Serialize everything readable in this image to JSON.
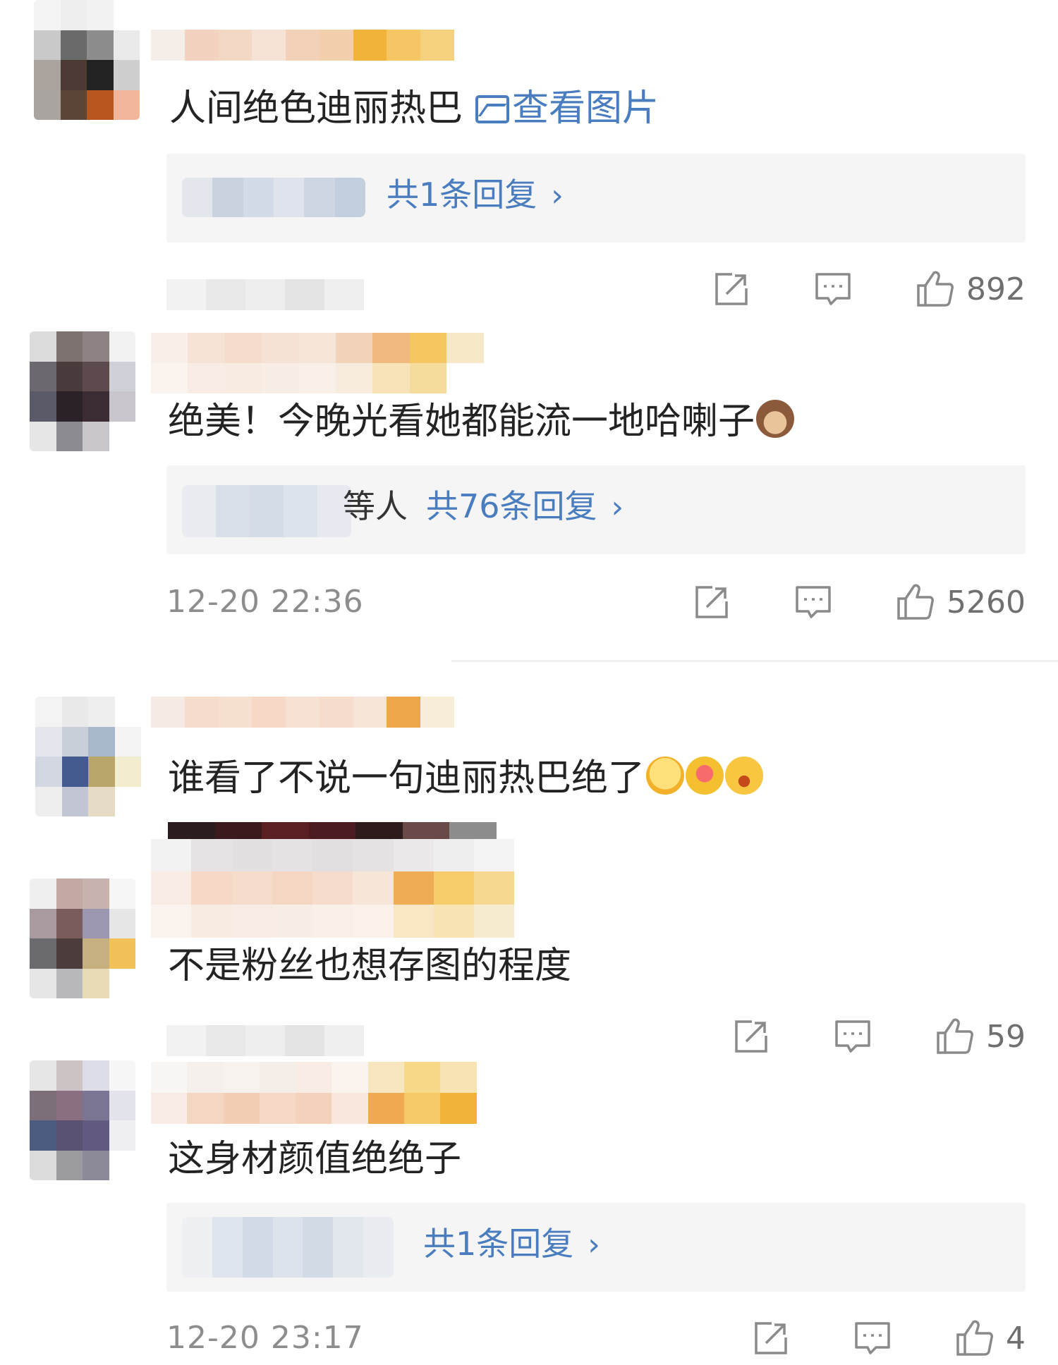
{
  "comments": [
    {
      "text": "人间绝色迪丽热巴",
      "view_image": "查看图片",
      "reply": {
        "extra": "",
        "count_label": "共1条回复"
      },
      "timestamp": "",
      "likes": "892",
      "avatar_colors": [
        "#c9c9c9",
        "#6a6a6a",
        "#8d8d8d",
        "#eaeaea",
        "#aaa39e",
        "#4b3b34",
        "#222222",
        "#d0cfcf",
        "#a9a49f",
        "#5b4638",
        "#b8561f",
        "#f2b69b",
        "#e5e5e5",
        "#dcd7d3",
        "#efe2d8",
        "#ffffff"
      ]
    },
    {
      "text": "绝美！今晚光看她都能流一地哈喇子",
      "emojis": [
        "monkey"
      ],
      "reply": {
        "extra": "等人",
        "count_label": "共76条回复"
      },
      "timestamp": "12-20 22:36",
      "likes": "5260",
      "avatar_colors": [
        "#dcdcdc",
        "#7c7270",
        "#8d8383",
        "#f2f2f2",
        "#6b6870",
        "#4a3c3c",
        "#5d4a4c",
        "#cfd0d8",
        "#5a5a68",
        "#2a2228",
        "#3c2c33",
        "#c9c5cc",
        "#e6e6e6",
        "#8e8c93",
        "#c8c6cb",
        "#ffffff"
      ]
    },
    {
      "text": "谁看了不说一句迪丽热巴绝了",
      "emojis": [
        "dizzy",
        "heart-eyes",
        "surprised"
      ],
      "reply": null,
      "timestamp": "",
      "likes": "",
      "avatar_colors": [
        "#f3f3f3",
        "#e9e9e9",
        "#eeeeee",
        "#ffffff",
        "#e3e6ec",
        "#c9cfd9",
        "#a9b7cc",
        "#f3f3f3",
        "#d3d7e2",
        "#425a8e",
        "#b8a66a",
        "#f3edcf",
        "#eeeeee",
        "#c2c5d3",
        "#e6dcc5",
        "#ffffff"
      ]
    },
    {
      "text": "不是粉丝也想存图的程度",
      "reply": null,
      "timestamp": "",
      "likes": "59",
      "avatar_colors": [
        "#f0f0f0",
        "#c3a8a3",
        "#c8b3ae",
        "#f6f6f6",
        "#a99aa0",
        "#7a5b5c",
        "#9b97b1",
        "#e6e6e6",
        "#6b6b6f",
        "#4c3c3c",
        "#c6b07f",
        "#f2c15a",
        "#e6e6e6",
        "#b8b8bd",
        "#e8dcb8",
        "#ffffff"
      ]
    },
    {
      "text": "这身材颜值绝绝子",
      "reply": {
        "extra": "",
        "count_label": "共1条回复"
      },
      "timestamp": "12-20 23:17",
      "likes": "4",
      "avatar_colors": [
        "#e6e6e6",
        "#ccc3c4",
        "#dddde8",
        "#f7f7f7",
        "#7c6f7a",
        "#8a6f80",
        "#7a7593",
        "#e4e4ec",
        "#4c5c80",
        "#5a5272",
        "#625a80",
        "#f0f0f4",
        "#dcdcdc",
        "#9a9a9f",
        "#8c8a98",
        "#ffffff"
      ]
    }
  ],
  "colors": {
    "link": "#4a7dbf",
    "reply_bg": "#f5f5f5",
    "meta_gray": "#8d8d8d"
  }
}
